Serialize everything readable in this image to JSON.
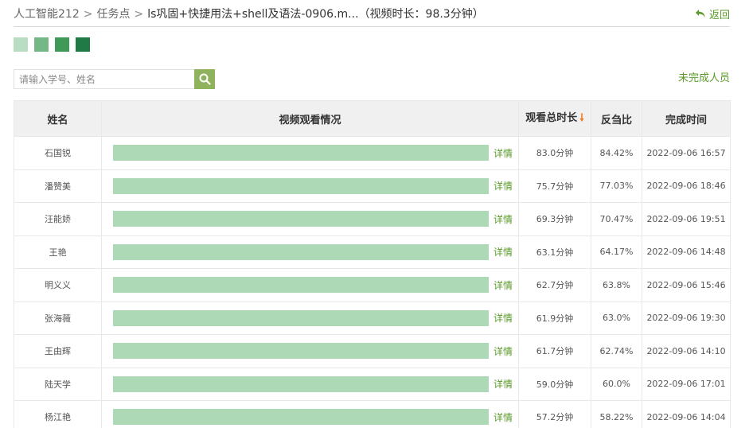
{
  "breadcrumb": {
    "course": "人工智能212",
    "separator": ">",
    "section": "任务点",
    "current": "ls巩固+快捷用法+shell及语法-0906.m...",
    "duration_note": "（视频时长：98.3分钟）"
  },
  "back_label": "返回",
  "legend_colors": [
    "#b9ddc3",
    "#75b888",
    "#3f9a57",
    "#207a45"
  ],
  "search": {
    "placeholder": "请输入学号、姓名",
    "value": ""
  },
  "unfinished_label": "未完成人员",
  "columns": {
    "name": "姓名",
    "watch": "视频观看情况",
    "total": "观看总时长",
    "ratio": "反刍比",
    "finish": "完成时间"
  },
  "colors": {
    "accent": "#5b9a2a",
    "bar": "#aed9b6",
    "sort_arrow": "#f07b1e"
  },
  "detail_label": "详情",
  "rows": [
    {
      "name": "石国锐",
      "progress": 1.0,
      "total": "83.0分钟",
      "ratio": "84.42%",
      "finish": "2022-09-06 16:57"
    },
    {
      "name": "潘赞美",
      "progress": 1.0,
      "total": "75.7分钟",
      "ratio": "77.03%",
      "finish": "2022-09-06 18:46"
    },
    {
      "name": "汪能娇",
      "progress": 1.0,
      "total": "69.3分钟",
      "ratio": "70.47%",
      "finish": "2022-09-06 19:51"
    },
    {
      "name": "王艳",
      "progress": 1.0,
      "total": "63.1分钟",
      "ratio": "64.17%",
      "finish": "2022-09-06 14:48"
    },
    {
      "name": "明义义",
      "progress": 1.0,
      "total": "62.7分钟",
      "ratio": "63.8%",
      "finish": "2022-09-06 15:46"
    },
    {
      "name": "张海薇",
      "progress": 1.0,
      "total": "61.9分钟",
      "ratio": "63.0%",
      "finish": "2022-09-06 19:30"
    },
    {
      "name": "王由辉",
      "progress": 1.0,
      "total": "61.7分钟",
      "ratio": "62.74%",
      "finish": "2022-09-06 14:10"
    },
    {
      "name": "陆天学",
      "progress": 1.0,
      "total": "59.0分钟",
      "ratio": "60.0%",
      "finish": "2022-09-06 17:01"
    },
    {
      "name": "杨江艳",
      "progress": 1.0,
      "total": "57.2分钟",
      "ratio": "58.22%",
      "finish": "2022-09-06 14:04"
    }
  ]
}
